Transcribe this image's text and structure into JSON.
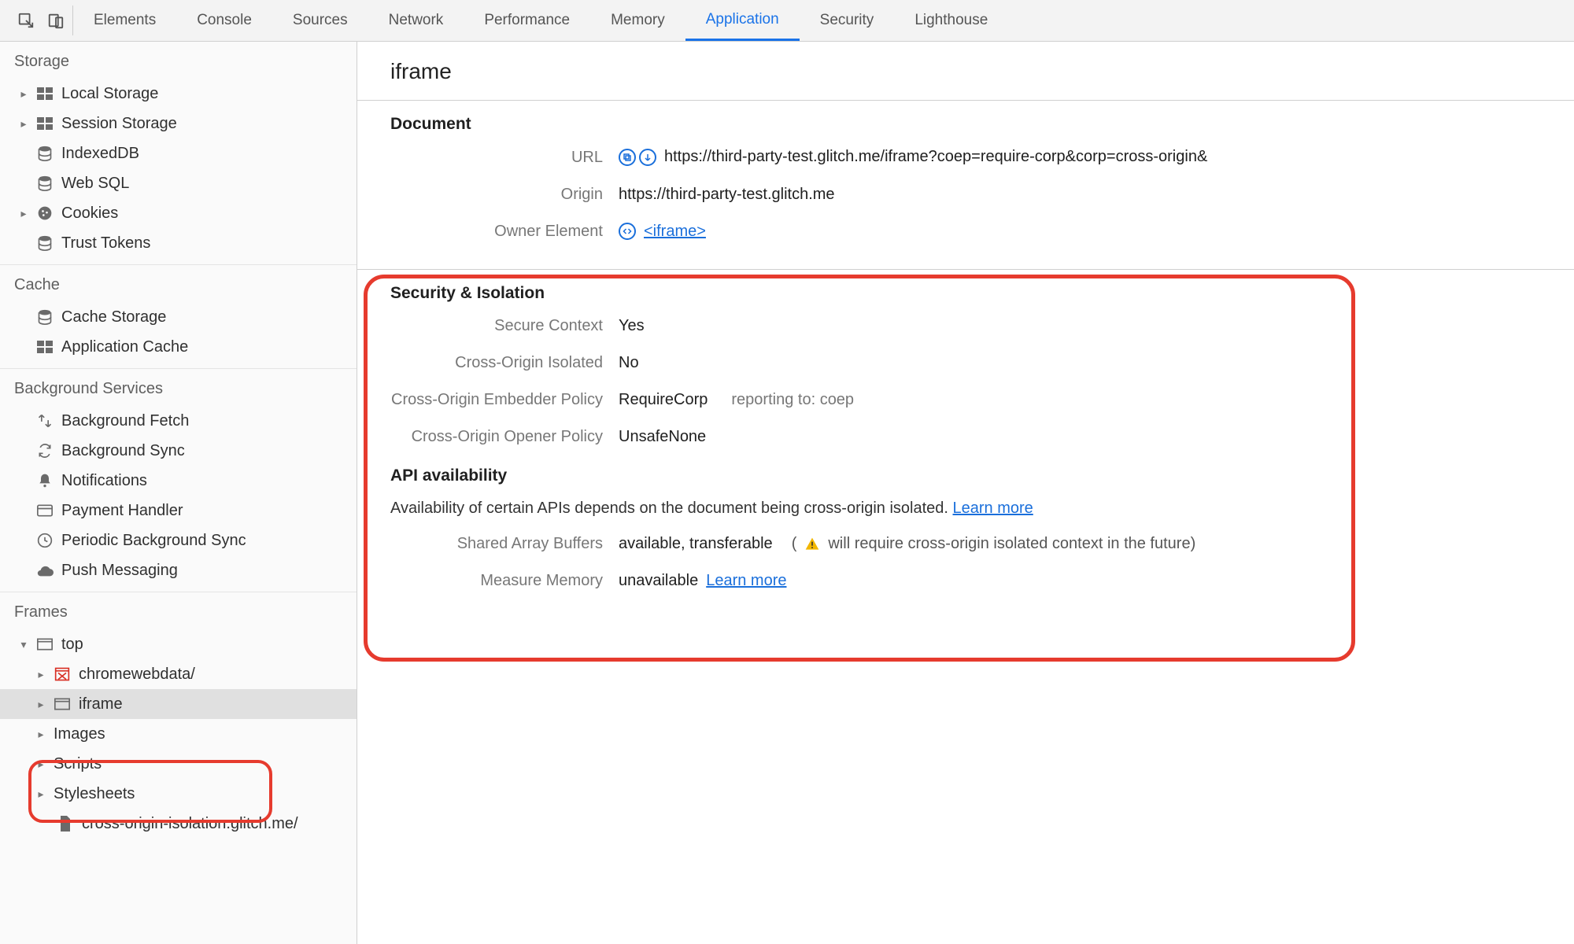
{
  "tabs": [
    "Elements",
    "Console",
    "Sources",
    "Network",
    "Performance",
    "Memory",
    "Application",
    "Security",
    "Lighthouse"
  ],
  "active_tab": "Application",
  "sidebar": {
    "storage": {
      "title": "Storage",
      "items": [
        "Local Storage",
        "Session Storage",
        "IndexedDB",
        "Web SQL",
        "Cookies",
        "Trust Tokens"
      ]
    },
    "cache": {
      "title": "Cache",
      "items": [
        "Cache Storage",
        "Application Cache"
      ]
    },
    "bg": {
      "title": "Background Services",
      "items": [
        "Background Fetch",
        "Background Sync",
        "Notifications",
        "Payment Handler",
        "Periodic Background Sync",
        "Push Messaging"
      ]
    },
    "frames": {
      "title": "Frames",
      "top": "top",
      "children": [
        {
          "label": "chromewebdata/",
          "icon": "error",
          "caret": "closed"
        },
        {
          "label": "iframe",
          "icon": "window",
          "caret": "closed",
          "selected": true
        }
      ],
      "more": [
        "Images",
        "Scripts",
        "Stylesheets"
      ],
      "leaf": "cross-origin-isolation.glitch.me/"
    }
  },
  "page": {
    "title": "iframe",
    "doc": {
      "heading": "Document",
      "url_label": "URL",
      "url_value": "https://third-party-test.glitch.me/iframe?coep=require-corp&corp=cross-origin&",
      "origin_label": "Origin",
      "origin_value": "https://third-party-test.glitch.me",
      "owner_label": "Owner Element",
      "owner_value": "<iframe>"
    },
    "sec": {
      "heading": "Security & Isolation",
      "secure_ctx_label": "Secure Context",
      "secure_ctx_value": "Yes",
      "coi_label": "Cross-Origin Isolated",
      "coi_value": "No",
      "coep_label": "Cross-Origin Embedder Policy",
      "coep_value": "RequireCorp",
      "coep_extra_label": "reporting to:",
      "coep_extra_value": "coep",
      "coop_label": "Cross-Origin Opener Policy",
      "coop_value": "UnsafeNone"
    },
    "api": {
      "heading": "API availability",
      "desc": "Availability of certain APIs depends on the document being cross-origin isolated.",
      "learn_more": "Learn more",
      "sab_label": "Shared Array Buffers",
      "sab_value": "available, transferable",
      "sab_warn": "will require cross-origin isolated context in the future)",
      "mm_label": "Measure Memory",
      "mm_value": "unavailable",
      "mm_learn": "Learn more"
    }
  }
}
